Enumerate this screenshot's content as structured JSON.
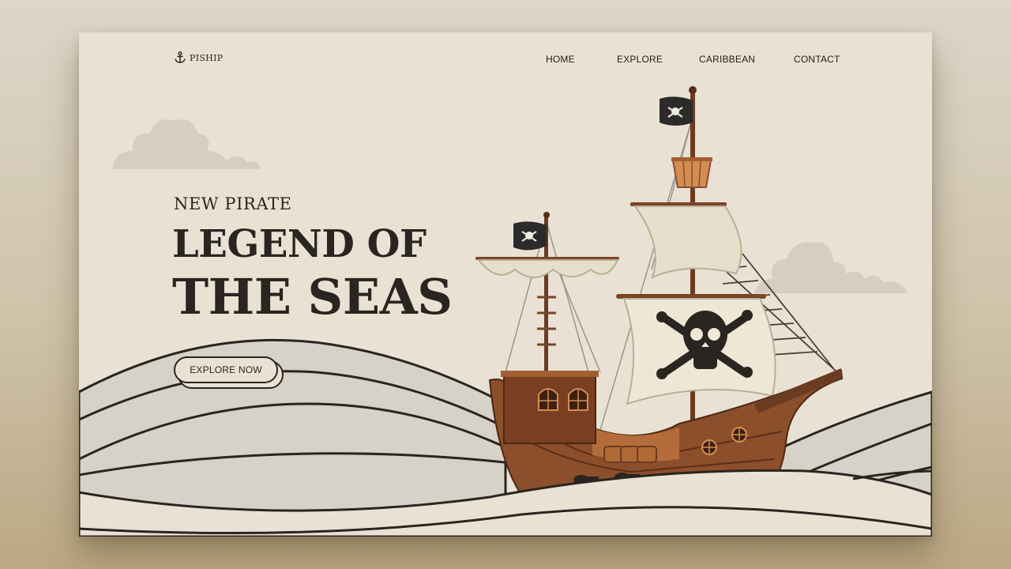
{
  "brand": {
    "name": "PISHIP",
    "logo_icon": "anchor-icon"
  },
  "nav": {
    "items": [
      {
        "label": "HOME"
      },
      {
        "label": "EXPLORE"
      },
      {
        "label": "CARIBBEAN"
      },
      {
        "label": "CONTACT"
      }
    ]
  },
  "hero": {
    "kicker": "NEW PIRATE",
    "title_line1": "LEGEND OF",
    "title_line2": "THE SEAS",
    "cta_label": "EXPLORE NOW"
  },
  "illustration": {
    "subject": "pirate-ship",
    "flag_icon": "skull-crossbones-icon"
  },
  "colors": {
    "page_bg": "#e9e2d4",
    "text_dark": "#2a2520",
    "wave_fill": "#d6d1c6",
    "cloud": "#d3cdc2",
    "wood": "#8c4f2b",
    "sail": "#efe7d5"
  }
}
